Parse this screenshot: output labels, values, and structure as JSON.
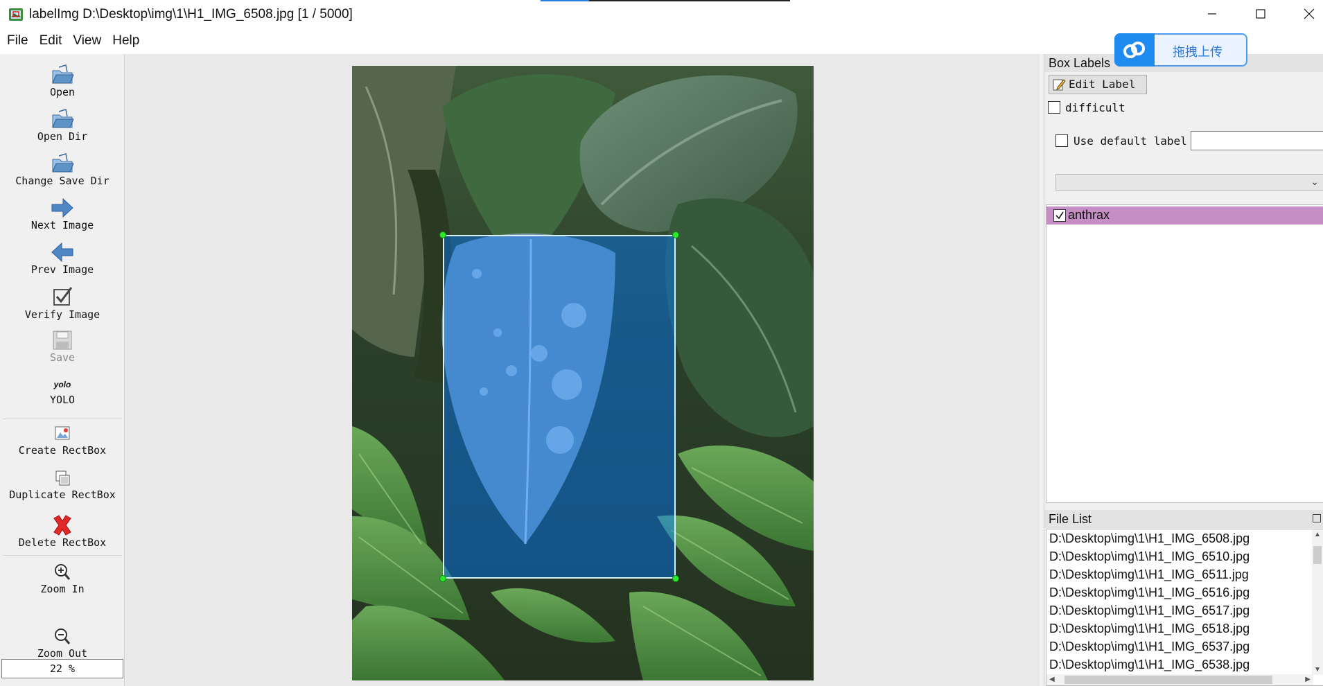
{
  "window": {
    "title": "labelImg D:\\Desktop\\img\\1\\H1_IMG_6508.jpg [1 / 5000]",
    "controls": [
      "minimize",
      "maximize",
      "close"
    ]
  },
  "menu": [
    "File",
    "Edit",
    "View",
    "Help"
  ],
  "toolbar": {
    "open": "Open",
    "open_dir": "Open Dir",
    "change_save_dir": "Change Save Dir",
    "next_image": "Next Image",
    "prev_image": "Prev Image",
    "verify_image": "Verify Image",
    "save": "Save",
    "format_icon_text": "yolo",
    "format": "YOLO",
    "create_rectbox": "Create RectBox",
    "duplicate_rectbox": "Duplicate RectBox",
    "delete_rectbox": "Delete RectBox",
    "zoom_in": "Zoom In",
    "zoom_value": "22 %",
    "zoom_out": "Zoom Out"
  },
  "canvas": {
    "image_alt": "leaf photo with fern background",
    "box_label": "anthrax"
  },
  "box_labels": {
    "header": "Box Labels",
    "edit_label": "Edit Label",
    "difficult": "difficult",
    "difficult_checked": false,
    "use_default_label": "Use default label",
    "use_default_checked": false,
    "default_label_value": "",
    "combo_value": "",
    "items": [
      {
        "label": "anthrax",
        "checked": true,
        "color": "#c58fc5"
      }
    ]
  },
  "file_list": {
    "header": "File List",
    "items": [
      "D:\\Desktop\\img\\1\\H1_IMG_6508.jpg",
      "D:\\Desktop\\img\\1\\H1_IMG_6510.jpg",
      "D:\\Desktop\\img\\1\\H1_IMG_6511.jpg",
      "D:\\Desktop\\img\\1\\H1_IMG_6516.jpg",
      "D:\\Desktop\\img\\1\\H1_IMG_6517.jpg",
      "D:\\Desktop\\img\\1\\H1_IMG_6518.jpg",
      "D:\\Desktop\\img\\1\\H1_IMG_6537.jpg",
      "D:\\Desktop\\img\\1\\H1_IMG_6538.jpg"
    ]
  },
  "upload_widget": {
    "text": "拖拽上传",
    "icon": "cloud-icon"
  },
  "colors": {
    "bbox_fill": "#0078ff",
    "vertex": "#2ee82e",
    "selected_label_bg": "#c58fc5",
    "accent": "#2a7de1"
  }
}
